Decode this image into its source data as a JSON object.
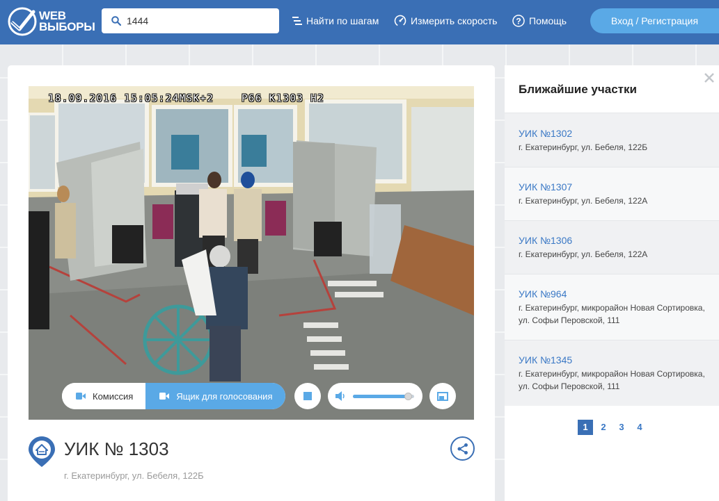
{
  "header": {
    "logo_line1": "WEB",
    "logo_line2": "ВЫБОРЫ",
    "search_value": "1444",
    "nav": [
      {
        "label": "Найти по шагам",
        "icon": "steps-icon"
      },
      {
        "label": "Измерить скорость",
        "icon": "speedometer-icon"
      },
      {
        "label": "Помощь",
        "icon": "help-icon"
      }
    ],
    "login_label": "Вход / Регистрация"
  },
  "player": {
    "osd_text": "18.09.2016 15:05:24MSK+2    P66 K1303 H2",
    "cameras": [
      {
        "label": "Комиссия",
        "active": false
      },
      {
        "label": "Ящик для голосования",
        "active": true
      }
    ],
    "volume": 0.9
  },
  "station": {
    "title": "УИК № 1303",
    "address": "г. Екатеринбург, ул. Бебеля, 122Б"
  },
  "nearby": {
    "title": "Ближайшие участки",
    "items": [
      {
        "name": "УИК №1302",
        "address": "г. Екатеринбург, ул. Бебеля, 122Б"
      },
      {
        "name": "УИК №1307",
        "address": "г. Екатеринбург, ул. Бебеля, 122А"
      },
      {
        "name": "УИК №1306",
        "address": "г. Екатеринбург, ул. Бебеля, 122А"
      },
      {
        "name": "УИК №964",
        "address": "г. Екатеринбург, микрорайон Новая Сортировка, ул. Софьи Перовской, 111"
      },
      {
        "name": "УИК №1345",
        "address": "г. Екатеринбург, микрорайон Новая Сортировка, ул. Софьи Перовской, 111"
      }
    ],
    "pages": [
      "1",
      "2",
      "3",
      "4"
    ],
    "current_page": "1"
  },
  "colors": {
    "header_bg": "#3a6fb5",
    "accent": "#5aa9e6",
    "link": "#3a78c5"
  }
}
